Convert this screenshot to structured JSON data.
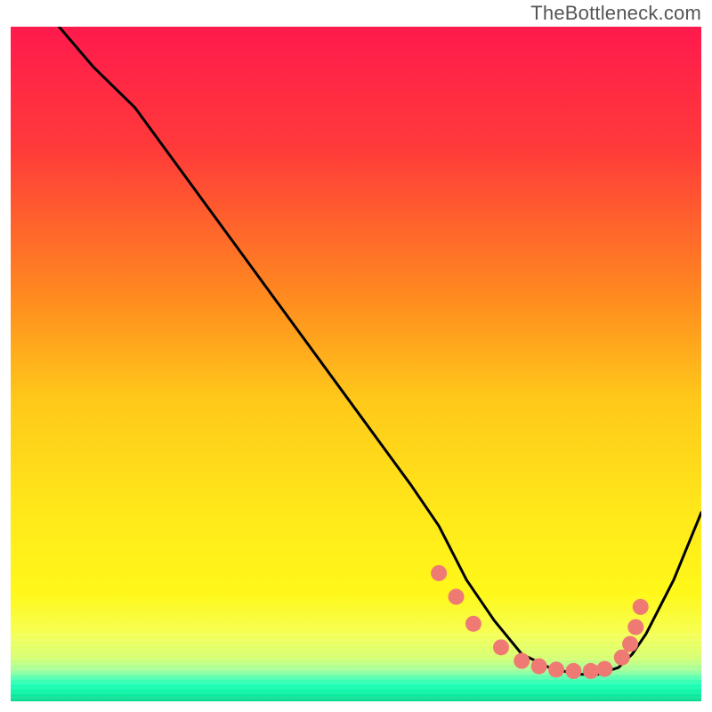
{
  "watermark": "TheBottleneck.com",
  "chart_data": {
    "type": "line",
    "title": "",
    "xlabel": "",
    "ylabel": "",
    "x_range": [
      0,
      100
    ],
    "y_range": [
      0,
      100
    ],
    "gradient_stops": [
      {
        "offset": 0.0,
        "color": "#ff1a4d"
      },
      {
        "offset": 0.18,
        "color": "#ff3a3a"
      },
      {
        "offset": 0.4,
        "color": "#ff8a1f"
      },
      {
        "offset": 0.55,
        "color": "#ffc81a"
      },
      {
        "offset": 0.72,
        "color": "#ffe81a"
      },
      {
        "offset": 0.84,
        "color": "#fff81a"
      },
      {
        "offset": 0.9,
        "color": "#f6ff55"
      },
      {
        "offset": 0.935,
        "color": "#d7ff70"
      },
      {
        "offset": 0.955,
        "color": "#9effa0"
      },
      {
        "offset": 0.965,
        "color": "#55ffb0"
      },
      {
        "offset": 0.975,
        "color": "#1fffb8"
      },
      {
        "offset": 0.985,
        "color": "#0bf7a6"
      },
      {
        "offset": 1.0,
        "color": "#09d890"
      }
    ],
    "series": [
      {
        "name": "bottleneck-curve",
        "x": [
          7,
          12,
          18,
          28,
          38,
          48,
          58,
          62,
          66,
          70,
          74,
          78,
          82,
          85,
          88,
          90,
          92,
          96,
          100
        ],
        "y": [
          100,
          94,
          88,
          74,
          60,
          46,
          32,
          26,
          18,
          12,
          7,
          5,
          4,
          4,
          5,
          7,
          10,
          18,
          28
        ]
      }
    ],
    "markers": {
      "name": "highlighted-points",
      "color": "#ef7a73",
      "radius": 9,
      "x": [
        62,
        64.5,
        67,
        71,
        74,
        76.5,
        79,
        81.5,
        84,
        86,
        88.5,
        89.7,
        90.5,
        91.2
      ],
      "y": [
        19,
        15.5,
        11.5,
        8,
        6,
        5.2,
        4.7,
        4.5,
        4.5,
        4.8,
        6.5,
        8.5,
        11,
        14
      ]
    }
  }
}
